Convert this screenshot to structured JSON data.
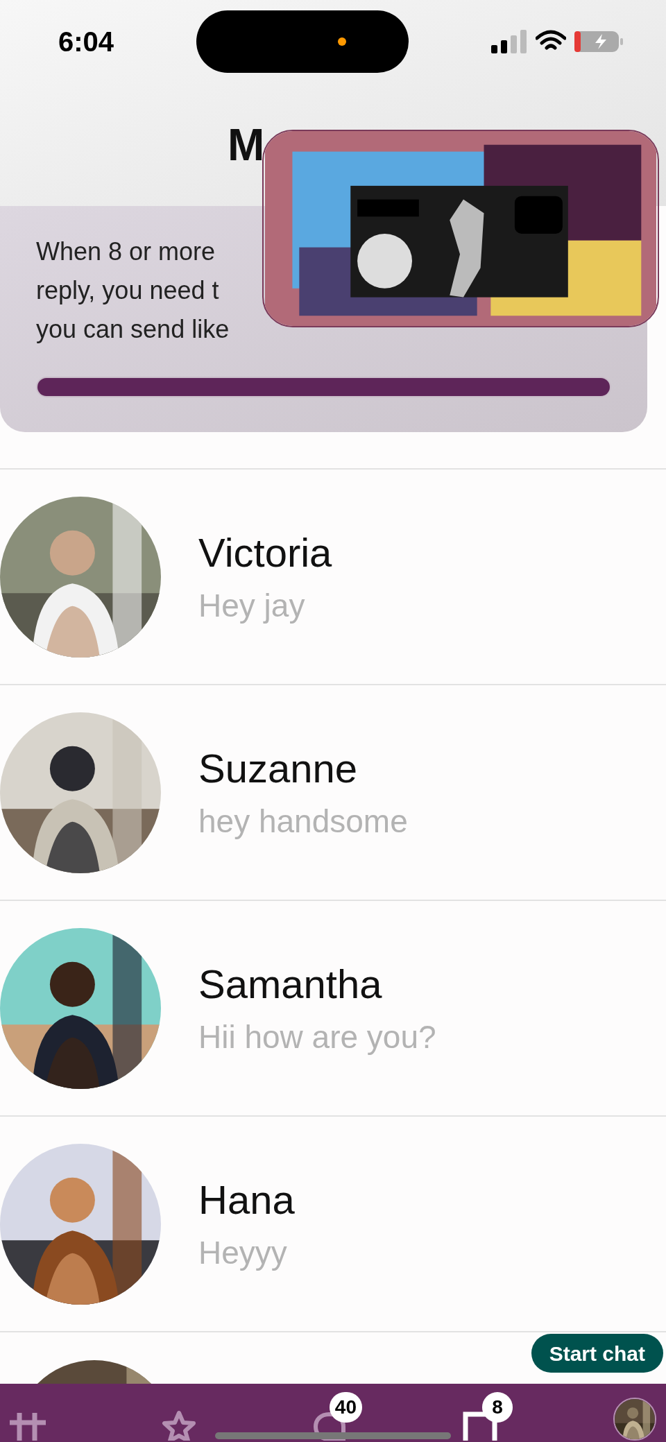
{
  "status_bar": {
    "time": "6:04"
  },
  "header": {
    "title": "M"
  },
  "notice": {
    "lines": [
      "When 8 or more",
      "reply, you need t",
      "you can send like"
    ],
    "progress": {
      "level": 1
    }
  },
  "chats": [
    {
      "name": "Victoria",
      "preview": "Hey jay"
    },
    {
      "name": "Suzanne",
      "preview": "hey handsome"
    },
    {
      "name": "Samantha",
      "preview": "Hii how are you?"
    },
    {
      "name": "Hana",
      "preview": "Heyyy"
    }
  ],
  "start_chat_button": "Start chat",
  "nav": [
    {
      "kind": "grid",
      "selected": false
    },
    {
      "kind": "star",
      "selected": false
    },
    {
      "kind": "chat",
      "badge": "40",
      "selected": false
    },
    {
      "kind": "square",
      "badge": "8",
      "selected": true
    },
    {
      "kind": "avatar",
      "selected": false
    }
  ]
}
